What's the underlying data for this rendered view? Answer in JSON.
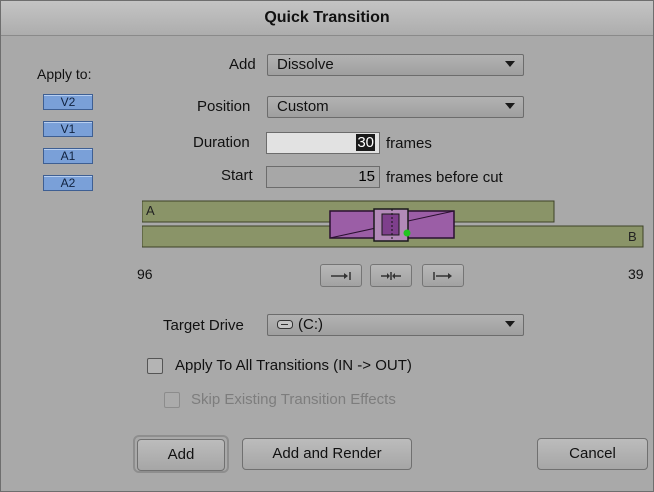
{
  "window": {
    "title": "Quick Transition"
  },
  "apply_to": {
    "label": "Apply to:",
    "tracks": [
      "V2",
      "V1",
      "A1",
      "A2"
    ]
  },
  "add": {
    "label": "Add",
    "selected": "Dissolve"
  },
  "position": {
    "label": "Position",
    "selected": "Custom"
  },
  "duration": {
    "label": "Duration",
    "value": "30",
    "unit": "frames"
  },
  "start": {
    "label": "Start",
    "value": "15",
    "unit": "frames before cut"
  },
  "timeline": {
    "track_a": "A",
    "track_b": "B",
    "left_value": "96",
    "right_value": "39"
  },
  "alignment_buttons": [
    {
      "icon": "end-at-cut-icon"
    },
    {
      "icon": "center-on-cut-icon"
    },
    {
      "icon": "start-at-cut-icon"
    }
  ],
  "target_drive": {
    "label": "Target Drive",
    "selected": "(C:)",
    "icon": "drive-icon"
  },
  "options": {
    "apply_all": {
      "label": "Apply To All Transitions (IN -> OUT)",
      "checked": false
    },
    "skip_existing": {
      "label": "Skip Existing Transition Effects",
      "checked": false,
      "enabled": false
    }
  },
  "buttons": {
    "add": "Add",
    "add_render": "Add and Render",
    "cancel": "Cancel"
  },
  "colors": {
    "track_button": "#7aa0d8",
    "clip_green": "#8a9468",
    "transition_purple": "#9b5ea6",
    "marker_green": "#22c422"
  }
}
